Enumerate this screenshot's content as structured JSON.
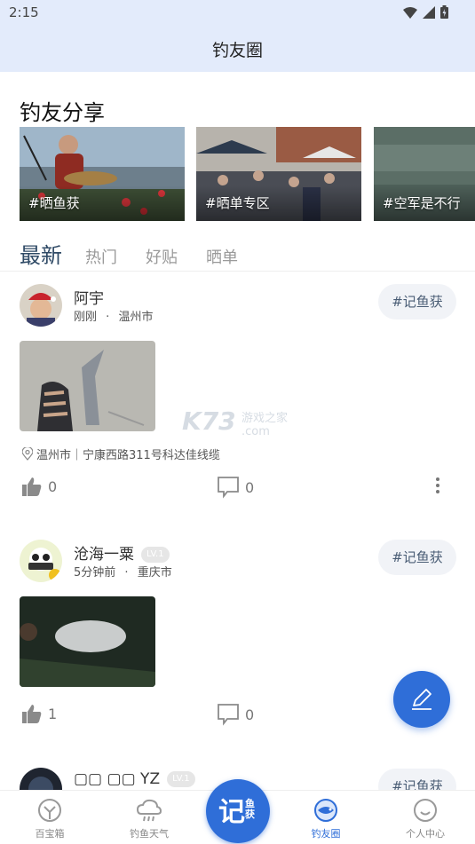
{
  "status": {
    "time": "2:15"
  },
  "header": {
    "title": "钓友圈"
  },
  "share": {
    "title": "钓友分享",
    "cards": [
      {
        "caption": "#晒鱼获"
      },
      {
        "caption": "#晒单专区"
      },
      {
        "caption": "#空军是不行"
      }
    ]
  },
  "tabs": [
    "最新",
    "热门",
    "好贴",
    "晒单"
  ],
  "posts": [
    {
      "username": "阿宇",
      "time": "刚刚",
      "city": "温州市",
      "tag": "#记鱼获",
      "location": "温州市｜宁康西路311号科达佳线缆",
      "likes": "0",
      "comments": "0"
    },
    {
      "username": "沧海一粟",
      "level": "LV.1",
      "time": "5分钟前",
      "city": "重庆市",
      "tag": "#记鱼获",
      "likes": "1",
      "comments": "0"
    },
    {
      "username": "▢▢ ▢▢ YZ",
      "level": "LV.1",
      "tag": "#记鱼获"
    }
  ],
  "meta_separator": "·",
  "watermark": {
    "main": "K73",
    "sub": "游戏之家",
    "domain": ".com"
  },
  "fab": {
    "icon": "edit-icon"
  },
  "bottom_nav": [
    {
      "label": "百宝箱",
      "icon": "toolbox-icon"
    },
    {
      "label": "钓鱼天气",
      "icon": "weather-icon"
    },
    {
      "label": "钓友圈",
      "icon": "fish-circle-icon",
      "active": true
    },
    {
      "label": "个人中心",
      "icon": "profile-icon"
    }
  ],
  "center_button": {
    "big": "记",
    "small": "鱼获"
  },
  "colors": {
    "accent": "#2f6ed8",
    "topbar": "#e3ebfb",
    "tab_active": "#2f4a66"
  }
}
